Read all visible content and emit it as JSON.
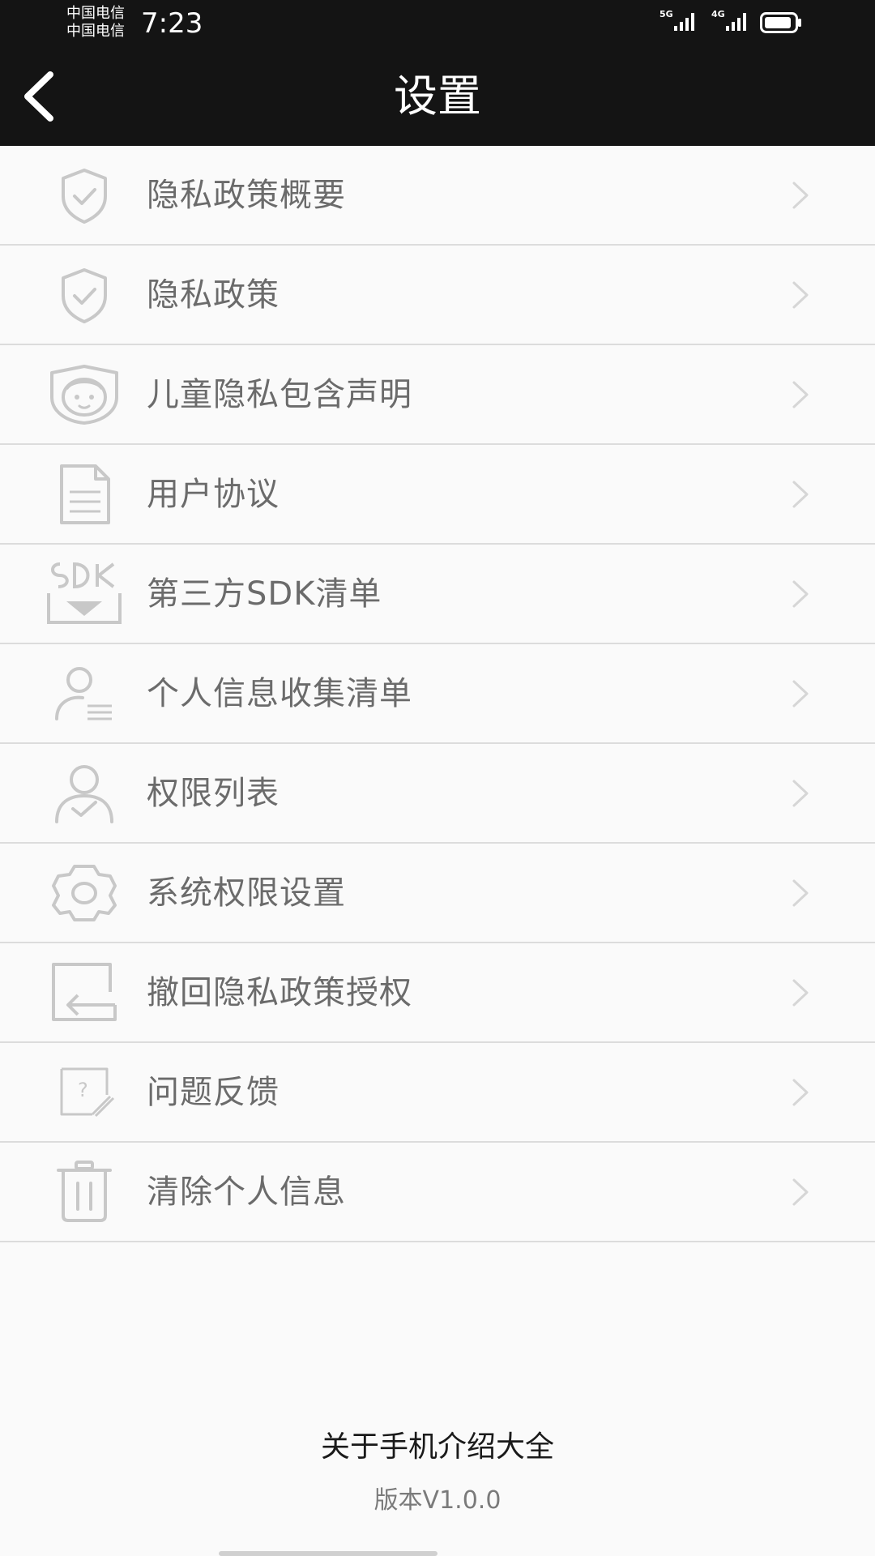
{
  "status_bar": {
    "carrier_1": "中国电信",
    "carrier_2": "中国电信",
    "time": "7:23",
    "signal_1_tag": "5G",
    "signal_2_tag": "4G"
  },
  "header": {
    "title": "设置"
  },
  "menu": {
    "items": [
      {
        "label": "隐私政策概要",
        "icon": "shield-check-icon"
      },
      {
        "label": "隐私政策",
        "icon": "shield-check-icon"
      },
      {
        "label": "儿童隐私包含声明",
        "icon": "child-face-icon"
      },
      {
        "label": "用户协议",
        "icon": "document-icon"
      },
      {
        "label": "第三方SDK清单",
        "icon": "sdk-download-icon"
      },
      {
        "label": "个人信息收集清单",
        "icon": "user-list-icon"
      },
      {
        "label": "权限列表",
        "icon": "user-check-icon"
      },
      {
        "label": "系统权限设置",
        "icon": "gear-icon"
      },
      {
        "label": "撤回隐私政策授权",
        "icon": "revoke-arrow-icon"
      },
      {
        "label": "问题反馈",
        "icon": "feedback-question-icon"
      },
      {
        "label": "清除个人信息",
        "icon": "trash-icon"
      }
    ]
  },
  "footer": {
    "about": "关于手机介绍大全",
    "version": "版本V1.0.0"
  },
  "colors": {
    "header_bg": "#141414",
    "page_bg": "#fafafa",
    "label_text": "#6b6b6b",
    "icon_stroke": "#c8c8c8"
  }
}
